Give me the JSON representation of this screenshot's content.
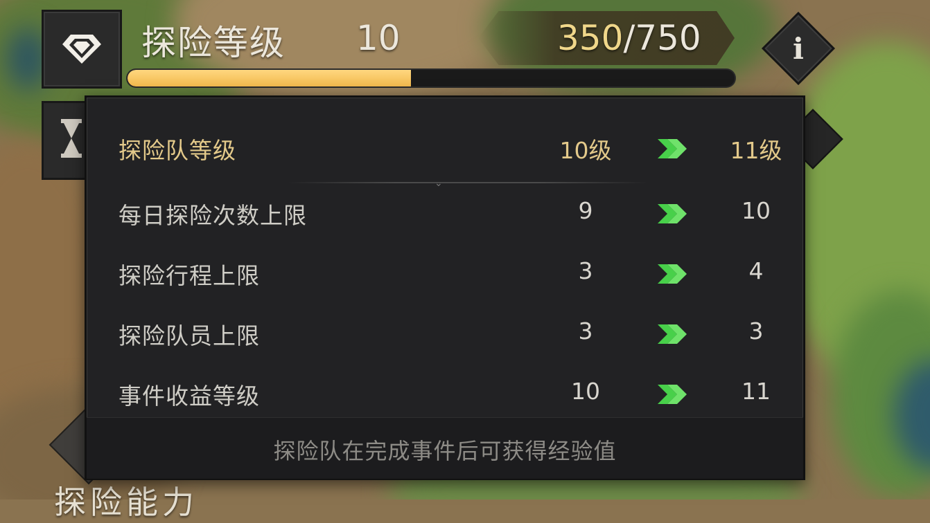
{
  "header": {
    "title": "探险等级",
    "level": "10",
    "exp_current": "350",
    "exp_separator": "/",
    "exp_total": "750",
    "exp_progress_fraction": 0.4667,
    "info_icon": "info-icon",
    "level_icon": "diamond-emblem-icon"
  },
  "panel": {
    "rows": [
      {
        "label": "探险队等级",
        "from": "10级",
        "to": "11级"
      },
      {
        "label": "每日探险次数上限",
        "from": "9",
        "to": "10"
      },
      {
        "label": "探险行程上限",
        "from": "3",
        "to": "4"
      },
      {
        "label": "探险队员上限",
        "from": "3",
        "to": "3"
      },
      {
        "label": "事件收益等级",
        "from": "10",
        "to": "11"
      }
    ],
    "footer": "探险队在完成事件后可获得经验值"
  },
  "background": {
    "bottom_label": "探险能力"
  },
  "colors": {
    "accent_gold": "#e3c98a",
    "progress_fill": "#f1b94d",
    "arrow_green": "#48d04a",
    "panel_bg": "#222224"
  }
}
